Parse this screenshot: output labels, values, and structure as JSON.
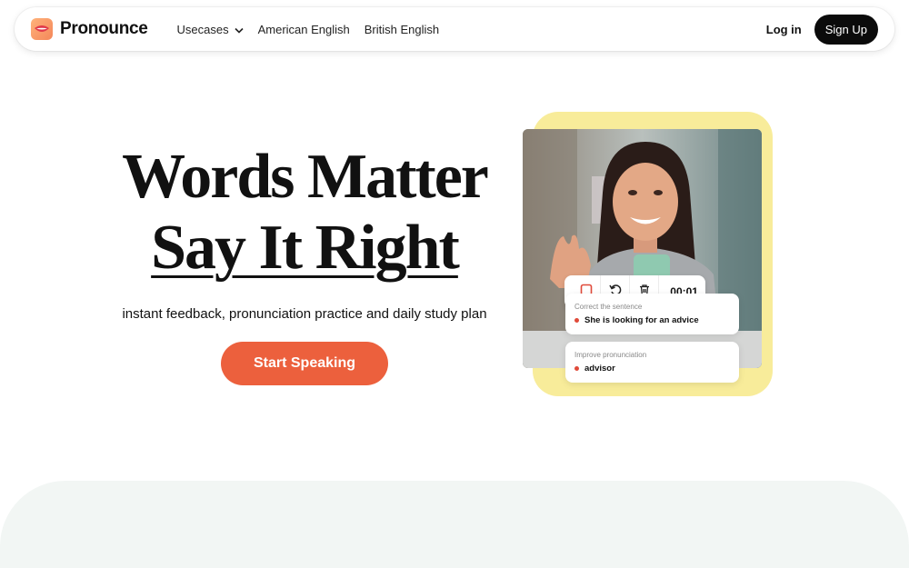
{
  "nav": {
    "brand": "Pronounce",
    "links": [
      {
        "label": "Usecases",
        "dropdown": true
      },
      {
        "label": "American English"
      },
      {
        "label": "British English"
      }
    ],
    "login": "Log in",
    "signup": "Sign Up"
  },
  "hero": {
    "title_line1": "Words Matter",
    "title_line2": "Say It Right",
    "subtitle": "instant feedback, pronunciation practice and daily study plan",
    "cta": "Start Speaking"
  },
  "recorder": {
    "timer": "00:01",
    "icons": [
      "stop-icon",
      "undo-icon",
      "trash-icon"
    ]
  },
  "cards": [
    {
      "label": "Correct the sentence",
      "text": "She is looking for an advice"
    },
    {
      "label": "Improve pronunciation",
      "text": "advisor"
    }
  ],
  "colors": {
    "accent": "#ec603d",
    "signup_bg": "#0b0b0b",
    "card_highlight": "#f8ec9a",
    "bottom_section": "#f2f6f4"
  }
}
